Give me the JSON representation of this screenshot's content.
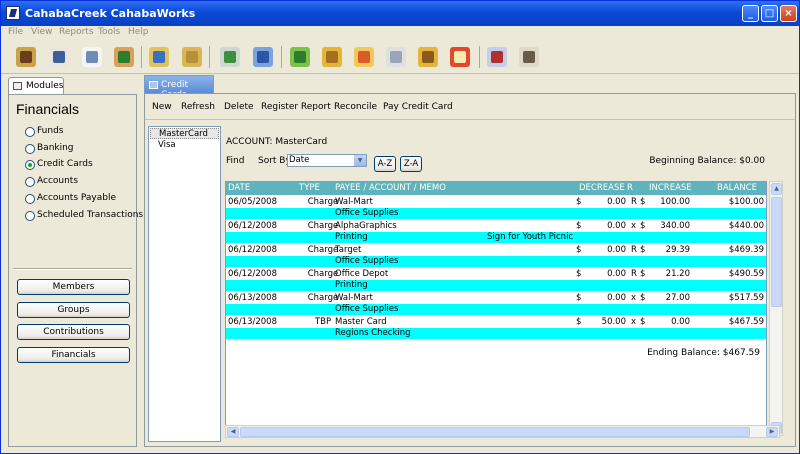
{
  "window": {
    "title": "CahabaCreek CahabaWorks",
    "minimize": "_",
    "maximize": "□",
    "close": "×"
  },
  "menu": [
    "File",
    "View",
    "Reports",
    "Tools",
    "Help"
  ],
  "modules_tab": "Modules",
  "credit_cards_tab": "Credit Cards",
  "financials": {
    "title": "Financials",
    "options": [
      "Funds",
      "Banking",
      "Credit Cards",
      "Accounts",
      "Accounts Payable",
      "Scheduled Transactions"
    ],
    "selected": "Credit Cards"
  },
  "nav_buttons": [
    "Members",
    "Groups",
    "Contributions",
    "Financials"
  ],
  "actions": [
    "New",
    "Refresh",
    "Delete",
    "Register Report",
    "Reconcile",
    "Pay Credit Card"
  ],
  "accounts": [
    "MasterCard",
    "Visa"
  ],
  "selected_account": "MasterCard",
  "account_label": "ACCOUNT: MasterCard",
  "find_label": "Find",
  "sort_by_label": "Sort By",
  "sort_by_value": "Date",
  "sort_az": "A-Z",
  "sort_za": "Z-A",
  "beginning_balance": "Beginning Balance: $0.00",
  "ending_balance": "Ending Balance: $467.59",
  "columns": [
    "DATE",
    "TYPE",
    "PAYEE / ACCOUNT / MEMO",
    "DECREASE",
    "R",
    "INCREASE",
    "BALANCE"
  ],
  "transactions": [
    {
      "date": "06/05/2008",
      "type": "Charge",
      "payee": "Wal-Mart",
      "dec_sign": "$",
      "decrease": "0.00",
      "r": "R",
      "inc_sign": "$",
      "increase": "100.00",
      "balance": "$100.00",
      "account": "Office Supplies",
      "memo": ""
    },
    {
      "date": "06/12/2008",
      "type": "Charge",
      "payee": "AlphaGraphics",
      "dec_sign": "$",
      "decrease": "0.00",
      "r": "x",
      "inc_sign": "$",
      "increase": "340.00",
      "balance": "$440.00",
      "account": "Printing",
      "memo": "Sign for Youth Picnic"
    },
    {
      "date": "06/12/2008",
      "type": "Charge",
      "payee": "Target",
      "dec_sign": "$",
      "decrease": "0.00",
      "r": "R",
      "inc_sign": "$",
      "increase": "29.39",
      "balance": "$469.39",
      "account": "Office Supplies",
      "memo": ""
    },
    {
      "date": "06/12/2008",
      "type": "Charge",
      "payee": "Office Depot",
      "dec_sign": "$",
      "decrease": "0.00",
      "r": "R",
      "inc_sign": "$",
      "increase": "21.20",
      "balance": "$490.59",
      "account": "Printing",
      "memo": ""
    },
    {
      "date": "06/13/2008",
      "type": "Charge",
      "payee": "Wal-Mart",
      "dec_sign": "$",
      "decrease": "0.00",
      "r": "x",
      "inc_sign": "$",
      "increase": "27.00",
      "balance": "$517.59",
      "account": "Office Supplies",
      "memo": ""
    },
    {
      "date": "06/13/2008",
      "type": "TBP",
      "payee": "Master Card",
      "dec_sign": "$",
      "decrease": "50.00",
      "r": "x",
      "inc_sign": "$",
      "increase": "0.00",
      "balance": "$467.59",
      "account": "Regions Checking",
      "memo": ""
    }
  ],
  "toolbar_icons": [
    "address-book-icon",
    "newsletter-icon",
    "document-icon",
    "members-icon",
    "footprints-icon",
    "people-icon",
    "envelope-money-icon",
    "basket-icon",
    "money-transfer-icon",
    "package-icon",
    "credit-card-icon",
    "grid-icon",
    "boxes-icon",
    "alarm-clock-icon",
    "meeting-icon",
    "masks-icon"
  ]
}
